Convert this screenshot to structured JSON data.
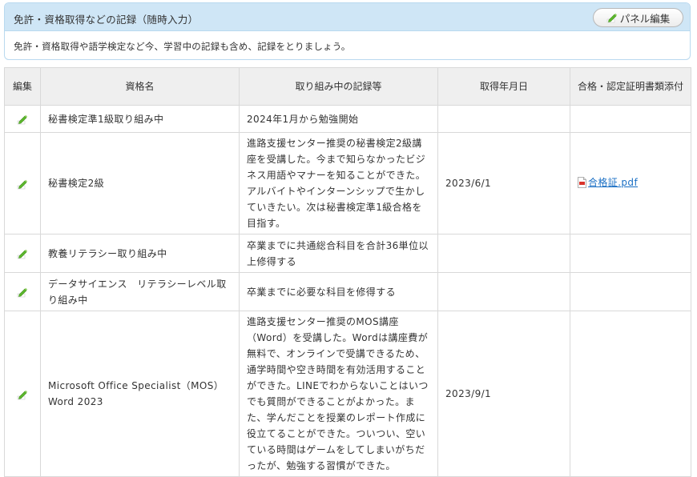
{
  "panel": {
    "title": "免許・資格取得などの記録（随時入力）",
    "edit_button_label": "パネル編集",
    "description": "免許・資格取得や語学検定など今、学習中の記録も含め、記録をとりましょう。"
  },
  "table": {
    "headers": {
      "edit": "編集",
      "name": "資格名",
      "record": "取り組み中の記録等",
      "date": "取得年月日",
      "attachment": "合格・認定証明書類添付"
    },
    "rows": [
      {
        "name": "秘書検定準1級取り組み中",
        "record": "2024年1月から勉強開始",
        "date": "",
        "attachment": ""
      },
      {
        "name": "秘書検定2級",
        "record": "進路支援センター推奨の秘書検定2級講座を受講した。今まで知らなかったビジネス用語やマナーを知ることができた。アルバイトやインターンシップで生かしていきたい。次は秘書検定準1級合格を目指す。",
        "date": "2023/6/1",
        "attachment": "合格証.pdf"
      },
      {
        "name": "教養リテラシー取り組み中",
        "record": "卒業までに共通総合科目を合計36単位以上修得する",
        "date": "",
        "attachment": ""
      },
      {
        "name": "データサイエンス　リテラシーレベル取り組み中",
        "record": "卒業までに必要な科目を修得する",
        "date": "",
        "attachment": ""
      },
      {
        "name": "Microsoft Office Specialist（MOS）Word 2023",
        "record": "進路支援センター推奨のMOS講座（Word）を受講した。Wordは講座費が無料で、オンラインで受講できるため、通学時間や空き時間を有効活用することができた。LINEでわからないことはいつでも質問ができることがよかった。また、学んだことを授業のレポート作成に役立てることができた。ついつい、空いている時間はゲームをしてしまいがちだったが、勉強する習慣ができた。",
        "date": "2023/9/1",
        "attachment": ""
      }
    ]
  },
  "icons": {
    "edit": "pencil-icon",
    "file": "pdf-file-icon"
  },
  "colors": {
    "header_bg": "#cfe6f6",
    "link": "#1a6fc4",
    "pencil_green": "#5cb82c"
  }
}
